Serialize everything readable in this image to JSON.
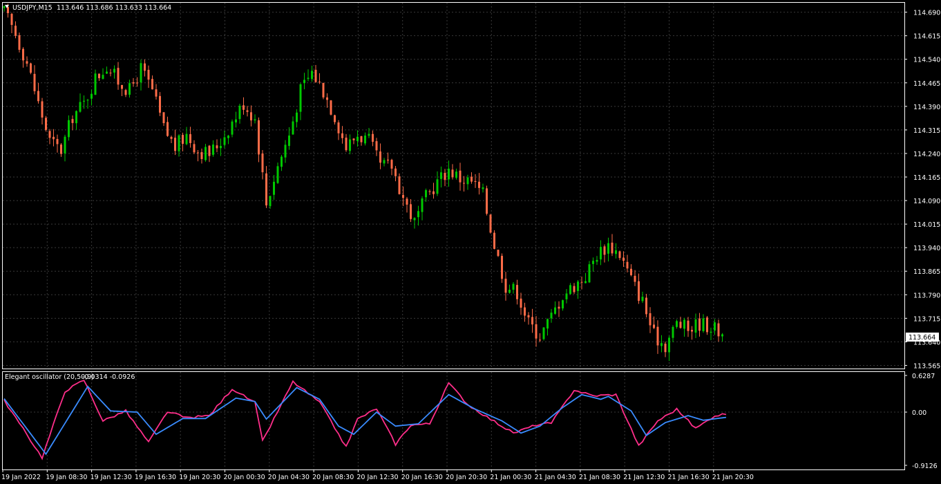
{
  "main_window": {
    "symbol_label": "USDJPY,M15",
    "ohlc_label": "113.646 113.686 113.633 113.664",
    "current_price_label": "113.664"
  },
  "indicator_window": {
    "label": "Elegant oscillator (20,50,9)",
    "values_label": "-0.0314 -0.0926",
    "scale_labels": [
      "0.6287",
      "0.00",
      "-0.9126"
    ]
  },
  "colors": {
    "background": "#000000",
    "frame": "#ffffff",
    "grid": "#3a3a3a",
    "bull_candle": "#00c800",
    "bear_candle": "#ff6c48",
    "oscillator_fast": "#ff2e8a",
    "oscillator_slow": "#3a8cff"
  },
  "chart_data": [
    {
      "type": "candlestick",
      "symbol": "USDJPY",
      "timeframe": "M15",
      "y_ticks": [
        "114.690",
        "114.615",
        "114.540",
        "114.465",
        "114.390",
        "114.315",
        "114.240",
        "114.165",
        "114.090",
        "114.015",
        "113.940",
        "113.865",
        "113.790",
        "113.715",
        "113.640",
        "113.565"
      ],
      "ylim": [
        113.555,
        114.72
      ],
      "x_ticks": [
        "19 Jan 2022",
        "19 Jan 08:30",
        "19 Jan 12:30",
        "19 Jan 16:30",
        "19 Jan 20:30",
        "20 Jan 00:30",
        "20 Jan 04:30",
        "20 Jan 08:30",
        "20 Jan 12:30",
        "20 Jan 16:30",
        "20 Jan 20:30",
        "21 Jan 00:30",
        "21 Jan 04:30",
        "21 Jan 08:30",
        "21 Jan 12:30",
        "21 Jan 16:30",
        "21 Jan 20:30"
      ],
      "close_path": [
        [
          0,
          114.69
        ],
        [
          3,
          114.62
        ],
        [
          6,
          114.53
        ],
        [
          9,
          114.4
        ],
        [
          12,
          114.28
        ],
        [
          15,
          114.25
        ],
        [
          18,
          114.36
        ],
        [
          21,
          114.4
        ],
        [
          24,
          114.48
        ],
        [
          27,
          114.52
        ],
        [
          30,
          114.47
        ],
        [
          33,
          114.44
        ],
        [
          36,
          114.51
        ],
        [
          39,
          114.44
        ],
        [
          42,
          114.32
        ],
        [
          45,
          114.26
        ],
        [
          48,
          114.3
        ],
        [
          51,
          114.25
        ],
        [
          54,
          114.24
        ],
        [
          57,
          114.28
        ],
        [
          60,
          114.34
        ],
        [
          63,
          114.4
        ],
        [
          66,
          114.35
        ],
        [
          69,
          114.08
        ],
        [
          72,
          114.2
        ],
        [
          75,
          114.3
        ],
        [
          78,
          114.44
        ],
        [
          81,
          114.5
        ],
        [
          84,
          114.44
        ],
        [
          87,
          114.36
        ],
        [
          90,
          114.26
        ],
        [
          93,
          114.3
        ],
        [
          96,
          114.28
        ],
        [
          99,
          114.2
        ],
        [
          102,
          114.2
        ],
        [
          105,
          114.1
        ],
        [
          108,
          114.02
        ],
        [
          111,
          114.1
        ],
        [
          114,
          114.15
        ],
        [
          117,
          114.19
        ],
        [
          120,
          114.16
        ],
        [
          123,
          114.15
        ],
        [
          126,
          114.11
        ],
        [
          129,
          113.95
        ],
        [
          132,
          113.82
        ],
        [
          135,
          113.8
        ],
        [
          138,
          113.7
        ],
        [
          141,
          113.66
        ],
        [
          144,
          113.72
        ],
        [
          147,
          113.79
        ],
        [
          150,
          113.82
        ],
        [
          153,
          113.85
        ],
        [
          156,
          113.92
        ],
        [
          159,
          113.95
        ],
        [
          162,
          113.92
        ],
        [
          165,
          113.84
        ],
        [
          168,
          113.77
        ],
        [
          171,
          113.66
        ],
        [
          174,
          113.63
        ],
        [
          177,
          113.7
        ],
        [
          180,
          113.68
        ],
        [
          183,
          113.7
        ],
        [
          186,
          113.69
        ],
        [
          189,
          113.664
        ]
      ]
    },
    {
      "type": "line",
      "name": "Elegant oscillator (20,50,9)",
      "ylim": [
        -0.9126,
        0.6287
      ],
      "series": [
        {
          "role": "fast",
          "points": [
            [
              0,
              0.2
            ],
            [
              10,
              -0.78
            ],
            [
              16,
              0.36
            ],
            [
              21,
              0.55
            ],
            [
              26,
              -0.15
            ],
            [
              32,
              0.02
            ],
            [
              38,
              -0.52
            ],
            [
              43,
              0.01
            ],
            [
              48,
              -0.1
            ],
            [
              54,
              -0.06
            ],
            [
              60,
              0.4
            ],
            [
              66,
              0.16
            ],
            [
              68,
              -0.5
            ],
            [
              76,
              0.52
            ],
            [
              83,
              0.17
            ],
            [
              90,
              -0.6
            ],
            [
              93,
              -0.12
            ],
            [
              98,
              0.06
            ],
            [
              103,
              -0.55
            ],
            [
              107,
              -0.22
            ],
            [
              112,
              -0.2
            ],
            [
              117,
              0.5
            ],
            [
              122,
              0.13
            ],
            [
              128,
              -0.12
            ],
            [
              134,
              -0.36
            ],
            [
              140,
              -0.22
            ],
            [
              144,
              -0.19
            ],
            [
              150,
              0.38
            ],
            [
              155,
              0.28
            ],
            [
              161,
              0.3
            ],
            [
              167,
              -0.58
            ],
            [
              172,
              -0.15
            ],
            [
              177,
              0.05
            ],
            [
              182,
              -0.28
            ],
            [
              187,
              -0.06
            ],
            [
              190,
              -0.03
            ]
          ]
        },
        {
          "role": "slow",
          "points": [
            [
              0,
              0.23
            ],
            [
              11,
              -0.72
            ],
            [
              22,
              0.44
            ],
            [
              28,
              0.02
            ],
            [
              35,
              0.0
            ],
            [
              40,
              -0.38
            ],
            [
              47,
              -0.11
            ],
            [
              53,
              -0.11
            ],
            [
              61,
              0.24
            ],
            [
              66,
              0.18
            ],
            [
              69,
              -0.12
            ],
            [
              77,
              0.42
            ],
            [
              83,
              0.22
            ],
            [
              88,
              -0.24
            ],
            [
              92,
              -0.38
            ],
            [
              98,
              0.0
            ],
            [
              103,
              -0.24
            ],
            [
              109,
              -0.2
            ],
            [
              117,
              0.3
            ],
            [
              124,
              0.05
            ],
            [
              131,
              -0.15
            ],
            [
              136,
              -0.36
            ],
            [
              141,
              -0.24
            ],
            [
              147,
              0.08
            ],
            [
              152,
              0.3
            ],
            [
              157,
              0.22
            ],
            [
              159,
              0.27
            ],
            [
              165,
              0.02
            ],
            [
              169,
              -0.4
            ],
            [
              174,
              -0.18
            ],
            [
              180,
              -0.06
            ],
            [
              184,
              -0.14
            ],
            [
              190,
              -0.09
            ]
          ]
        }
      ]
    }
  ]
}
